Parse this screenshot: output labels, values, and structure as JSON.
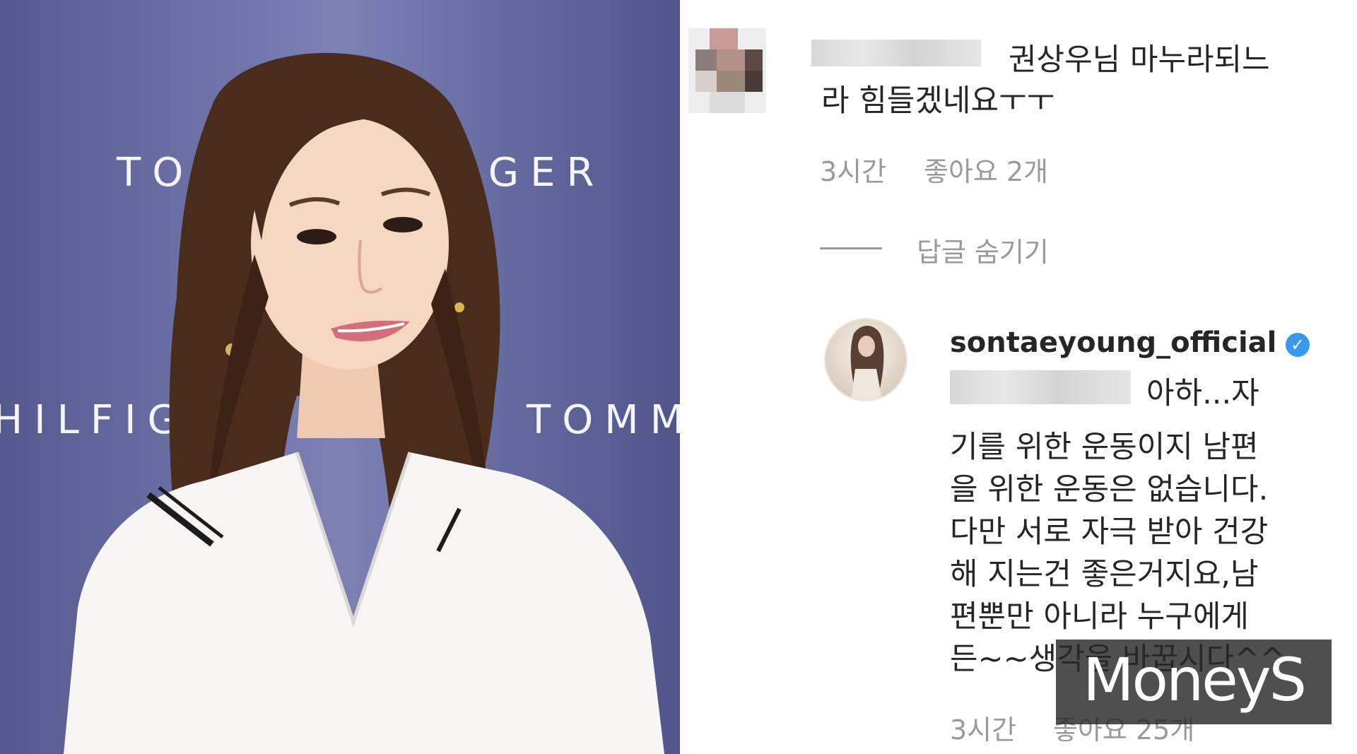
{
  "photo": {
    "backdrop_texts": [
      "TO",
      "FIGER",
      "HILFIG",
      "TOMM"
    ]
  },
  "comment": {
    "text_line1": "권상우님 마누라되느",
    "text_line2": "라 힘들겠네요ㅜㅜ",
    "time": "3시간",
    "likes": "좋아요 2개",
    "hide_replies": "답글 숨기기"
  },
  "reply": {
    "username": "sontaeyoung_official",
    "verified_icon": "verified-badge-icon",
    "lines": [
      "아하...자",
      "기를 위한 운동이지 남편",
      "을 위한 운동은 없습니다.",
      "다만 서로 자극 받아 건강",
      "해 지는건 좋은거지요,남",
      "편뿐만 아니라 누구에게",
      "든~~생각을 바꿉시다^^"
    ],
    "time": "3시간",
    "likes": "좋아요 25개"
  },
  "watermark": {
    "text": "MoneyS"
  },
  "colors": {
    "backdrop": "#6c72a6",
    "text": "#262626",
    "meta": "#9a9a9a",
    "verified": "#3897f0"
  }
}
